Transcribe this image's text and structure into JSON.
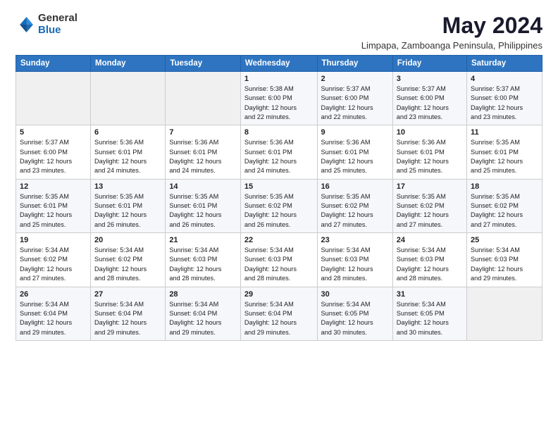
{
  "header": {
    "logo_general": "General",
    "logo_blue": "Blue",
    "title": "May 2024",
    "subtitle": "Limpapa, Zamboanga Peninsula, Philippines"
  },
  "weekdays": [
    "Sunday",
    "Monday",
    "Tuesday",
    "Wednesday",
    "Thursday",
    "Friday",
    "Saturday"
  ],
  "weeks": [
    [
      {
        "day": "",
        "info": ""
      },
      {
        "day": "",
        "info": ""
      },
      {
        "day": "",
        "info": ""
      },
      {
        "day": "1",
        "info": "Sunrise: 5:38 AM\nSunset: 6:00 PM\nDaylight: 12 hours\nand 22 minutes."
      },
      {
        "day": "2",
        "info": "Sunrise: 5:37 AM\nSunset: 6:00 PM\nDaylight: 12 hours\nand 22 minutes."
      },
      {
        "day": "3",
        "info": "Sunrise: 5:37 AM\nSunset: 6:00 PM\nDaylight: 12 hours\nand 23 minutes."
      },
      {
        "day": "4",
        "info": "Sunrise: 5:37 AM\nSunset: 6:00 PM\nDaylight: 12 hours\nand 23 minutes."
      }
    ],
    [
      {
        "day": "5",
        "info": "Sunrise: 5:37 AM\nSunset: 6:00 PM\nDaylight: 12 hours\nand 23 minutes."
      },
      {
        "day": "6",
        "info": "Sunrise: 5:36 AM\nSunset: 6:01 PM\nDaylight: 12 hours\nand 24 minutes."
      },
      {
        "day": "7",
        "info": "Sunrise: 5:36 AM\nSunset: 6:01 PM\nDaylight: 12 hours\nand 24 minutes."
      },
      {
        "day": "8",
        "info": "Sunrise: 5:36 AM\nSunset: 6:01 PM\nDaylight: 12 hours\nand 24 minutes."
      },
      {
        "day": "9",
        "info": "Sunrise: 5:36 AM\nSunset: 6:01 PM\nDaylight: 12 hours\nand 25 minutes."
      },
      {
        "day": "10",
        "info": "Sunrise: 5:36 AM\nSunset: 6:01 PM\nDaylight: 12 hours\nand 25 minutes."
      },
      {
        "day": "11",
        "info": "Sunrise: 5:35 AM\nSunset: 6:01 PM\nDaylight: 12 hours\nand 25 minutes."
      }
    ],
    [
      {
        "day": "12",
        "info": "Sunrise: 5:35 AM\nSunset: 6:01 PM\nDaylight: 12 hours\nand 25 minutes."
      },
      {
        "day": "13",
        "info": "Sunrise: 5:35 AM\nSunset: 6:01 PM\nDaylight: 12 hours\nand 26 minutes."
      },
      {
        "day": "14",
        "info": "Sunrise: 5:35 AM\nSunset: 6:01 PM\nDaylight: 12 hours\nand 26 minutes."
      },
      {
        "day": "15",
        "info": "Sunrise: 5:35 AM\nSunset: 6:02 PM\nDaylight: 12 hours\nand 26 minutes."
      },
      {
        "day": "16",
        "info": "Sunrise: 5:35 AM\nSunset: 6:02 PM\nDaylight: 12 hours\nand 27 minutes."
      },
      {
        "day": "17",
        "info": "Sunrise: 5:35 AM\nSunset: 6:02 PM\nDaylight: 12 hours\nand 27 minutes."
      },
      {
        "day": "18",
        "info": "Sunrise: 5:35 AM\nSunset: 6:02 PM\nDaylight: 12 hours\nand 27 minutes."
      }
    ],
    [
      {
        "day": "19",
        "info": "Sunrise: 5:34 AM\nSunset: 6:02 PM\nDaylight: 12 hours\nand 27 minutes."
      },
      {
        "day": "20",
        "info": "Sunrise: 5:34 AM\nSunset: 6:02 PM\nDaylight: 12 hours\nand 28 minutes."
      },
      {
        "day": "21",
        "info": "Sunrise: 5:34 AM\nSunset: 6:03 PM\nDaylight: 12 hours\nand 28 minutes."
      },
      {
        "day": "22",
        "info": "Sunrise: 5:34 AM\nSunset: 6:03 PM\nDaylight: 12 hours\nand 28 minutes."
      },
      {
        "day": "23",
        "info": "Sunrise: 5:34 AM\nSunset: 6:03 PM\nDaylight: 12 hours\nand 28 minutes."
      },
      {
        "day": "24",
        "info": "Sunrise: 5:34 AM\nSunset: 6:03 PM\nDaylight: 12 hours\nand 28 minutes."
      },
      {
        "day": "25",
        "info": "Sunrise: 5:34 AM\nSunset: 6:03 PM\nDaylight: 12 hours\nand 29 minutes."
      }
    ],
    [
      {
        "day": "26",
        "info": "Sunrise: 5:34 AM\nSunset: 6:04 PM\nDaylight: 12 hours\nand 29 minutes."
      },
      {
        "day": "27",
        "info": "Sunrise: 5:34 AM\nSunset: 6:04 PM\nDaylight: 12 hours\nand 29 minutes."
      },
      {
        "day": "28",
        "info": "Sunrise: 5:34 AM\nSunset: 6:04 PM\nDaylight: 12 hours\nand 29 minutes."
      },
      {
        "day": "29",
        "info": "Sunrise: 5:34 AM\nSunset: 6:04 PM\nDaylight: 12 hours\nand 29 minutes."
      },
      {
        "day": "30",
        "info": "Sunrise: 5:34 AM\nSunset: 6:05 PM\nDaylight: 12 hours\nand 30 minutes."
      },
      {
        "day": "31",
        "info": "Sunrise: 5:34 AM\nSunset: 6:05 PM\nDaylight: 12 hours\nand 30 minutes."
      },
      {
        "day": "",
        "info": ""
      }
    ]
  ]
}
